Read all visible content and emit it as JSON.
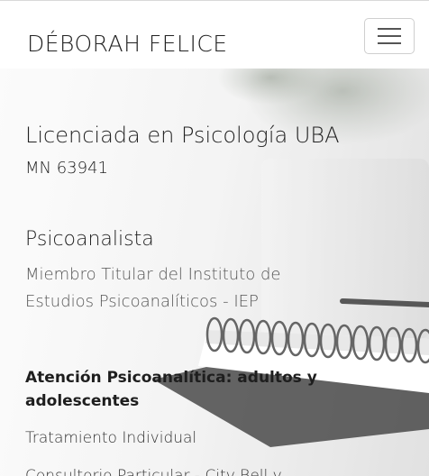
{
  "navbar": {
    "brand": "DÉBORAH FELICE",
    "toggler_icon": "hamburger-menu-icon"
  },
  "hero": {
    "title": "Licenciada en Psicología UBA",
    "license": "MN 63941",
    "role": "Psicoanalista",
    "membership": "Miembro Titular del Instituto de Estudios Psicoanalíticos - IEP",
    "service_heading": "Atención Psicoanalítica: adultos y adolescentes",
    "treatment": "Tratamiento Individual",
    "office": "Consultorio Particular - City Bell y"
  }
}
